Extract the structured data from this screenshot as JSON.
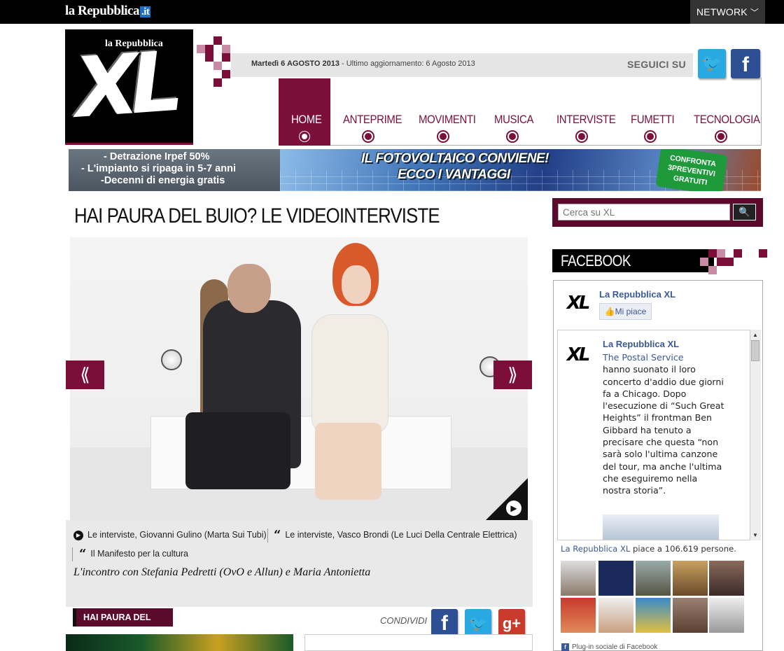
{
  "topbar": {
    "logo": "la Repubblica",
    "logo_suffix": ".it",
    "network_label": "NETWORK",
    "network_chevron": "chevron-down-icon"
  },
  "header": {
    "xl_brand": "la Repubblica",
    "xl_mark": "XL",
    "date_bold": "Martedì 6 AGOSTO 2013",
    "date_update": " - Ultimo aggiornamento: 6 Agosto 2013",
    "follow_label": "SEGUICI SU",
    "twitter_icon": "twitter-icon",
    "facebook_icon": "facebook-icon"
  },
  "nav": {
    "items": [
      {
        "label": "HOME",
        "active": true
      },
      {
        "label": "ANTEPRIME"
      },
      {
        "label": "MOVIMENTI"
      },
      {
        "label": "MUSICA"
      },
      {
        "label": "INTERVISTE"
      },
      {
        "label": "FUMETTI"
      },
      {
        "label": "TECNOLOGIA"
      }
    ]
  },
  "banner": {
    "left_lines": [
      "- Detrazione  Irpef 50%",
      "- L'impianto si  ripaga in 5-7 anni",
      "-Decenni di energia gratis"
    ],
    "headline_1": "IL FOTOVOLTAICO CONVIENE!",
    "headline_2": "ECCO I VANTAGGI",
    "badge": [
      "CONFRONTA",
      "3PREVENTIVI",
      "GRATUITI"
    ]
  },
  "main": {
    "title": "HAI PAURA DEL BUIO? LE VIDEOINTERVISTE",
    "prev_arrow": "⟪",
    "next_arrow": "⟫",
    "caption": {
      "links": [
        "Le interviste, Giovanni Gulino (Marta Sui Tubi)",
        "Le interviste, Vasco Brondi (Le Luci Della Centrale Elettrica)",
        "Il Manifesto per la cultura"
      ],
      "title": "L'incontro con Stefania Pedretti (OvO e Allun) e Maria Antonietta"
    },
    "tag": "HAI PAURA DEL BUIO?",
    "share_label": "CONDIVIDI",
    "share_icons": [
      "facebook-icon",
      "twitter-icon",
      "google-plus-icon"
    ]
  },
  "sidebar": {
    "search_placeholder": "Cerca su XL",
    "facebook_title": "FACEBOOK",
    "page_name": "La Repubblica XL",
    "like_button": "Mi piace",
    "post": {
      "author": "La Repubblica XL",
      "link": "The Postal Service",
      "text": "hanno suonato il loro concerto d'addio due giorni fa a Chicago. Dopo l'esecuzione di “Such Great Heights” il frontman Ben Gibbard ha tenuto a precisare che questa “non sarà solo l'ultima canzone del tour, ma anche l'ultima che eseguiremo nella nostra storia”."
    },
    "likes_page": "La Repubblica XL",
    "likes_text": " piace a 106.619 persone.",
    "plugin_label": "Plug-in sociale di Facebook"
  },
  "colors": {
    "accent": "#7b0f3a",
    "dark_accent": "#5c0a2b",
    "facebook": "#3b5998",
    "twitter": "#29a9e1"
  }
}
